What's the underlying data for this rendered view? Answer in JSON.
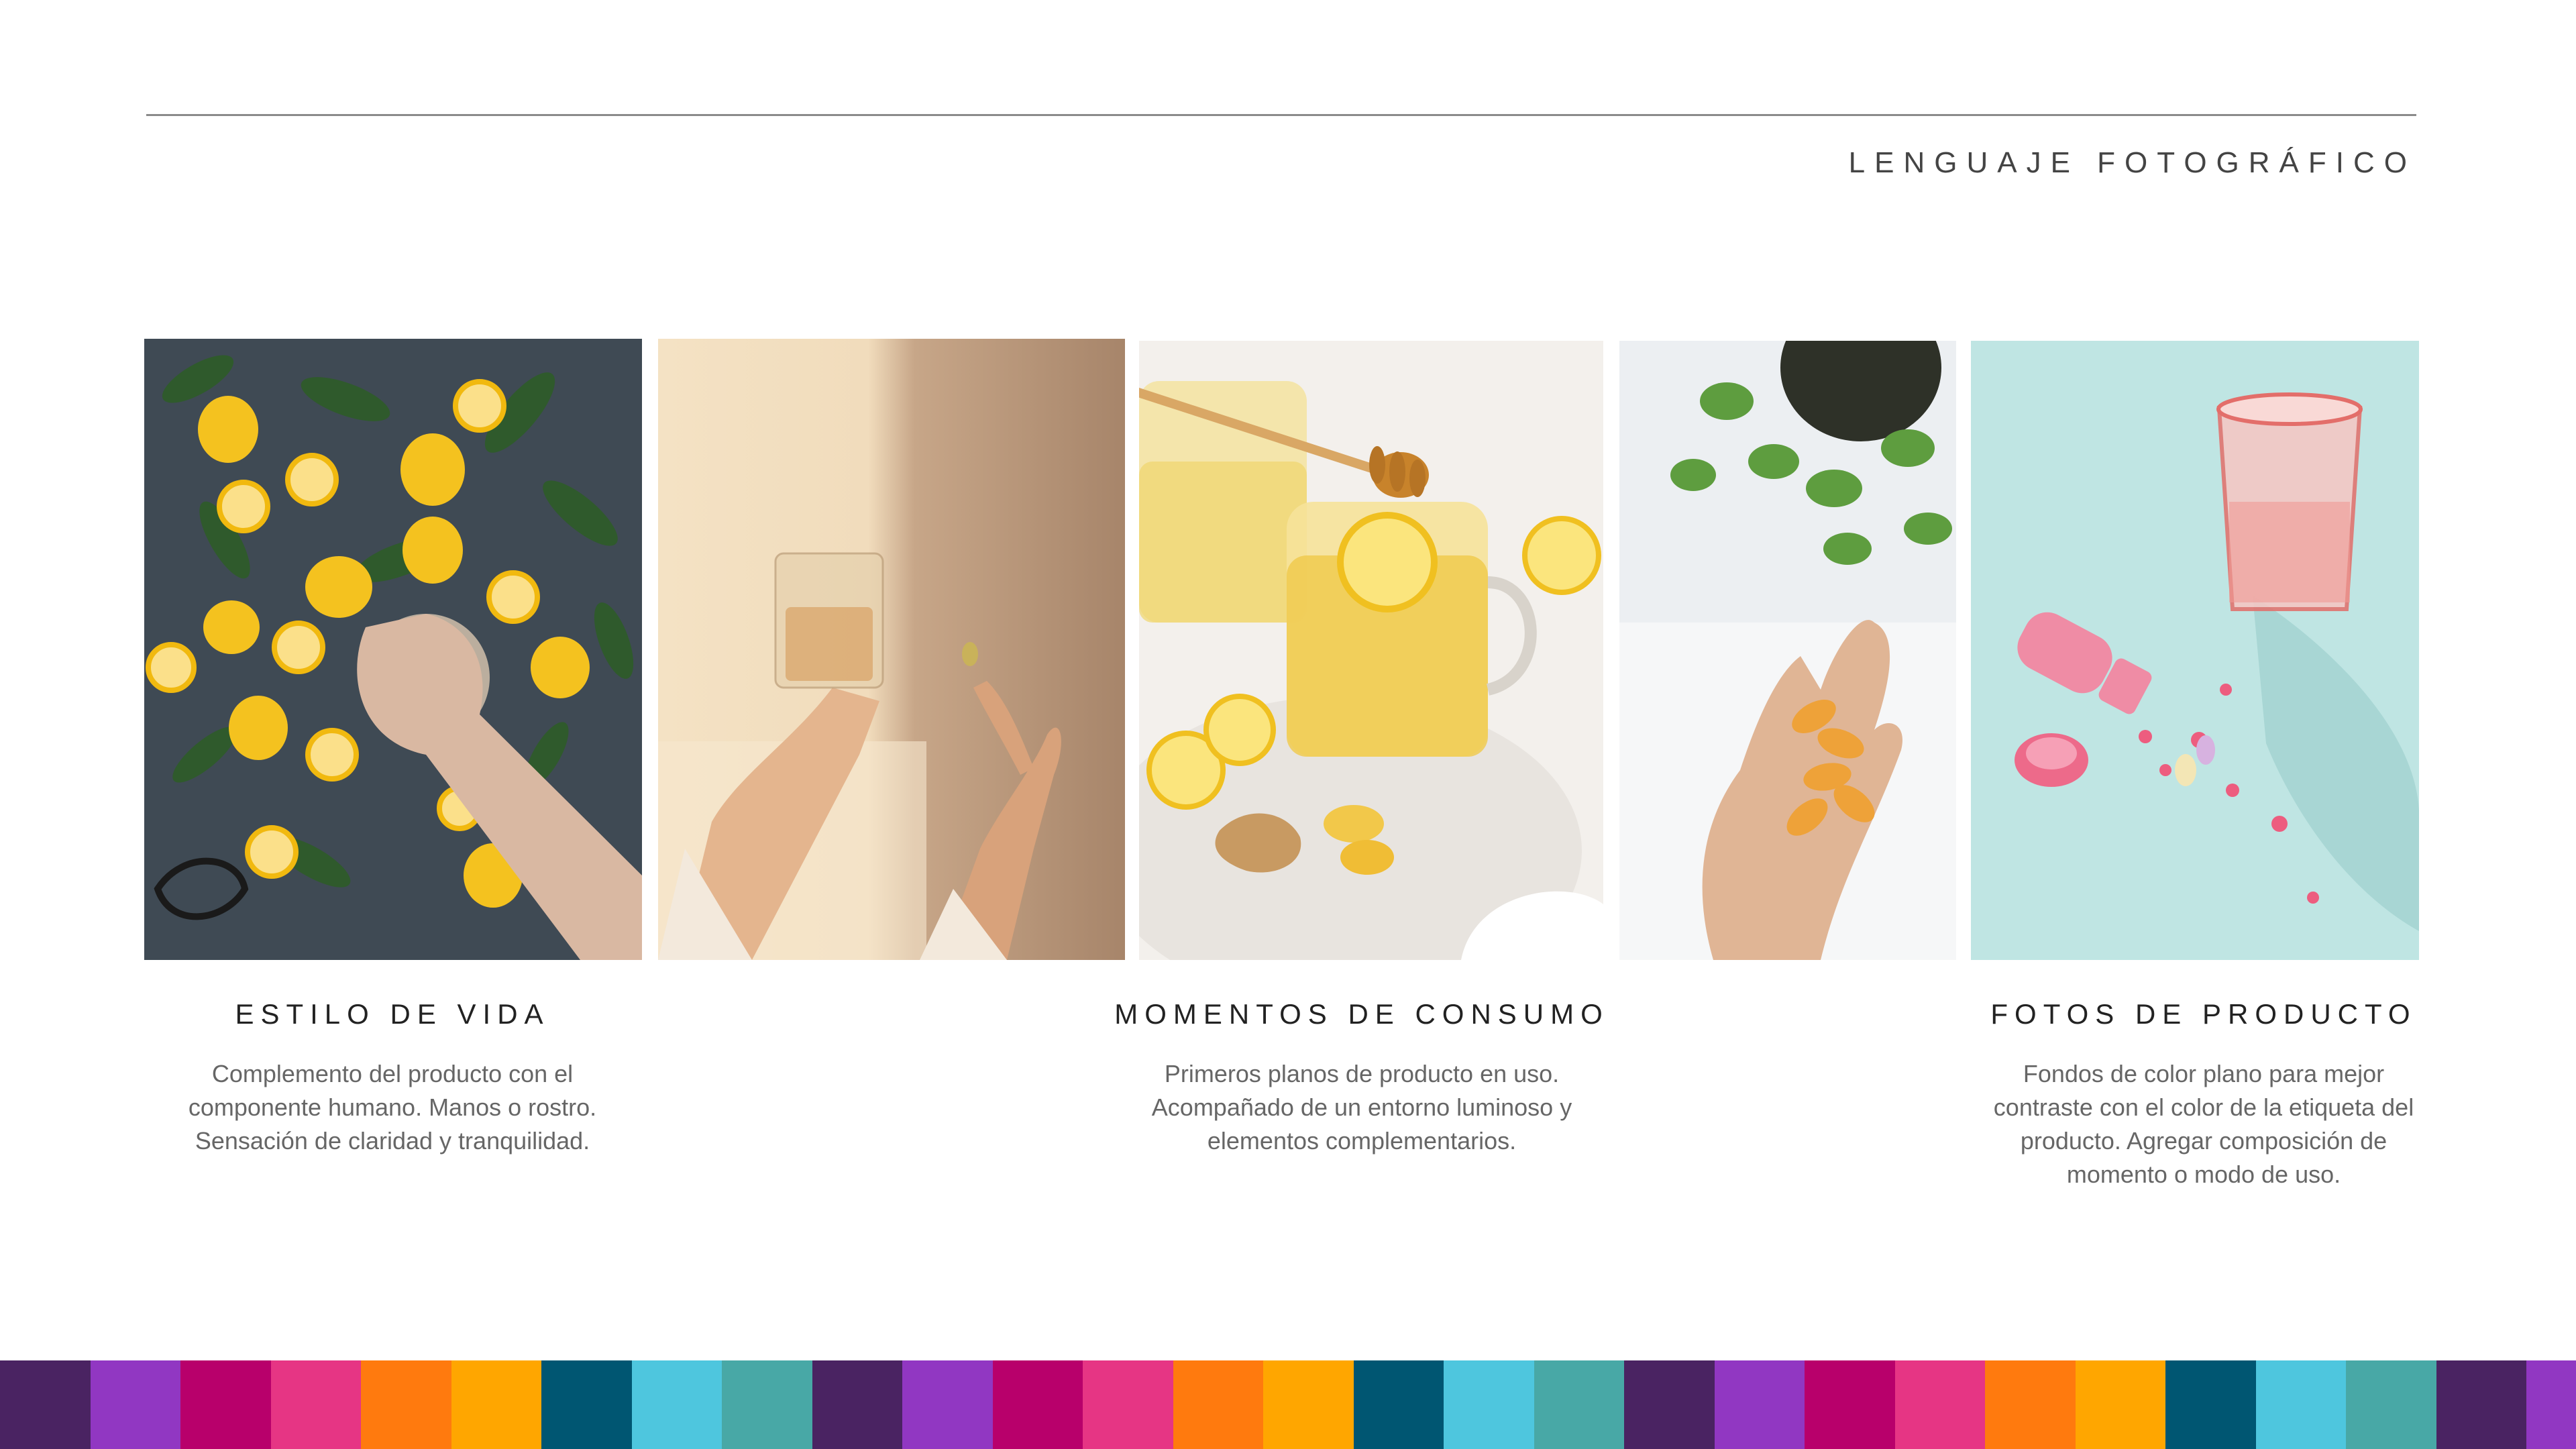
{
  "header": {
    "title": "LENGUAJE FOTOGRÁFICO"
  },
  "sections": [
    {
      "heading": "ESTILO DE VIDA",
      "lines": [
        "Complemento del producto con el",
        "componente humano. Manos o rostro.",
        "Sensación de claridad y tranquilidad."
      ]
    },
    {
      "heading": "MOMENTOS DE CONSUMO",
      "lines": [
        "Primeros planos de producto en uso.",
        "Acompañado de un entorno luminoso y",
        "elementos complementarios."
      ]
    },
    {
      "heading": "FOTOS DE PRODUCTO",
      "lines": [
        "Fondos de color plano para mejor",
        "contraste con el color de la etiqueta del",
        "producto. Agregar composición de",
        "momento o modo de uso."
      ]
    }
  ],
  "stripe_colors": [
    "#4a2362",
    "#9137c2",
    "#b8006b",
    "#e63584",
    "#ff7a0e",
    "#ffa600",
    "#005672",
    "#4ec6de",
    "#48a8a6"
  ]
}
